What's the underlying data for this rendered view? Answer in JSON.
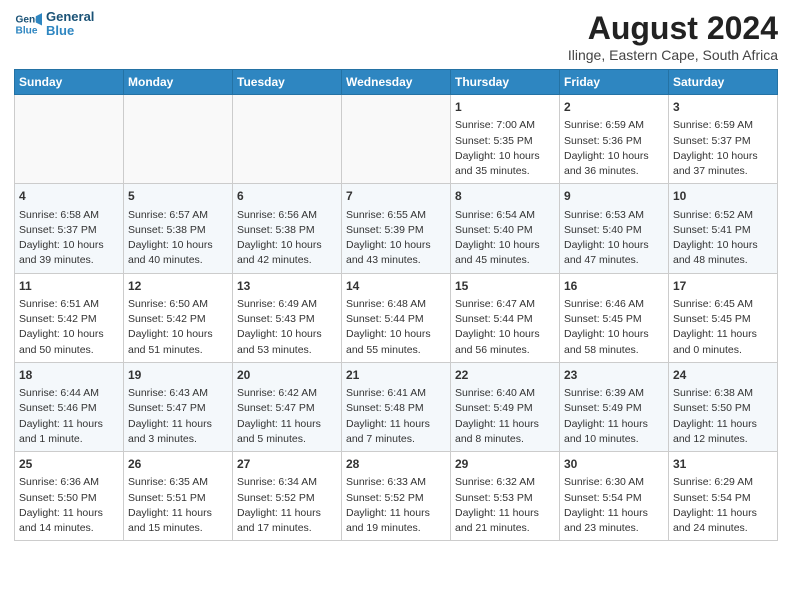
{
  "header": {
    "logo_line1": "General",
    "logo_line2": "Blue",
    "month_title": "August 2024",
    "location": "Ilinge, Eastern Cape, South Africa"
  },
  "weekdays": [
    "Sunday",
    "Monday",
    "Tuesday",
    "Wednesday",
    "Thursday",
    "Friday",
    "Saturday"
  ],
  "weeks": [
    [
      {
        "day": "",
        "info": ""
      },
      {
        "day": "",
        "info": ""
      },
      {
        "day": "",
        "info": ""
      },
      {
        "day": "",
        "info": ""
      },
      {
        "day": "1",
        "info": "Sunrise: 7:00 AM\nSunset: 5:35 PM\nDaylight: 10 hours\nand 35 minutes."
      },
      {
        "day": "2",
        "info": "Sunrise: 6:59 AM\nSunset: 5:36 PM\nDaylight: 10 hours\nand 36 minutes."
      },
      {
        "day": "3",
        "info": "Sunrise: 6:59 AM\nSunset: 5:37 PM\nDaylight: 10 hours\nand 37 minutes."
      }
    ],
    [
      {
        "day": "4",
        "info": "Sunrise: 6:58 AM\nSunset: 5:37 PM\nDaylight: 10 hours\nand 39 minutes."
      },
      {
        "day": "5",
        "info": "Sunrise: 6:57 AM\nSunset: 5:38 PM\nDaylight: 10 hours\nand 40 minutes."
      },
      {
        "day": "6",
        "info": "Sunrise: 6:56 AM\nSunset: 5:38 PM\nDaylight: 10 hours\nand 42 minutes."
      },
      {
        "day": "7",
        "info": "Sunrise: 6:55 AM\nSunset: 5:39 PM\nDaylight: 10 hours\nand 43 minutes."
      },
      {
        "day": "8",
        "info": "Sunrise: 6:54 AM\nSunset: 5:40 PM\nDaylight: 10 hours\nand 45 minutes."
      },
      {
        "day": "9",
        "info": "Sunrise: 6:53 AM\nSunset: 5:40 PM\nDaylight: 10 hours\nand 47 minutes."
      },
      {
        "day": "10",
        "info": "Sunrise: 6:52 AM\nSunset: 5:41 PM\nDaylight: 10 hours\nand 48 minutes."
      }
    ],
    [
      {
        "day": "11",
        "info": "Sunrise: 6:51 AM\nSunset: 5:42 PM\nDaylight: 10 hours\nand 50 minutes."
      },
      {
        "day": "12",
        "info": "Sunrise: 6:50 AM\nSunset: 5:42 PM\nDaylight: 10 hours\nand 51 minutes."
      },
      {
        "day": "13",
        "info": "Sunrise: 6:49 AM\nSunset: 5:43 PM\nDaylight: 10 hours\nand 53 minutes."
      },
      {
        "day": "14",
        "info": "Sunrise: 6:48 AM\nSunset: 5:44 PM\nDaylight: 10 hours\nand 55 minutes."
      },
      {
        "day": "15",
        "info": "Sunrise: 6:47 AM\nSunset: 5:44 PM\nDaylight: 10 hours\nand 56 minutes."
      },
      {
        "day": "16",
        "info": "Sunrise: 6:46 AM\nSunset: 5:45 PM\nDaylight: 10 hours\nand 58 minutes."
      },
      {
        "day": "17",
        "info": "Sunrise: 6:45 AM\nSunset: 5:45 PM\nDaylight: 11 hours\nand 0 minutes."
      }
    ],
    [
      {
        "day": "18",
        "info": "Sunrise: 6:44 AM\nSunset: 5:46 PM\nDaylight: 11 hours\nand 1 minute."
      },
      {
        "day": "19",
        "info": "Sunrise: 6:43 AM\nSunset: 5:47 PM\nDaylight: 11 hours\nand 3 minutes."
      },
      {
        "day": "20",
        "info": "Sunrise: 6:42 AM\nSunset: 5:47 PM\nDaylight: 11 hours\nand 5 minutes."
      },
      {
        "day": "21",
        "info": "Sunrise: 6:41 AM\nSunset: 5:48 PM\nDaylight: 11 hours\nand 7 minutes."
      },
      {
        "day": "22",
        "info": "Sunrise: 6:40 AM\nSunset: 5:49 PM\nDaylight: 11 hours\nand 8 minutes."
      },
      {
        "day": "23",
        "info": "Sunrise: 6:39 AM\nSunset: 5:49 PM\nDaylight: 11 hours\nand 10 minutes."
      },
      {
        "day": "24",
        "info": "Sunrise: 6:38 AM\nSunset: 5:50 PM\nDaylight: 11 hours\nand 12 minutes."
      }
    ],
    [
      {
        "day": "25",
        "info": "Sunrise: 6:36 AM\nSunset: 5:50 PM\nDaylight: 11 hours\nand 14 minutes."
      },
      {
        "day": "26",
        "info": "Sunrise: 6:35 AM\nSunset: 5:51 PM\nDaylight: 11 hours\nand 15 minutes."
      },
      {
        "day": "27",
        "info": "Sunrise: 6:34 AM\nSunset: 5:52 PM\nDaylight: 11 hours\nand 17 minutes."
      },
      {
        "day": "28",
        "info": "Sunrise: 6:33 AM\nSunset: 5:52 PM\nDaylight: 11 hours\nand 19 minutes."
      },
      {
        "day": "29",
        "info": "Sunrise: 6:32 AM\nSunset: 5:53 PM\nDaylight: 11 hours\nand 21 minutes."
      },
      {
        "day": "30",
        "info": "Sunrise: 6:30 AM\nSunset: 5:54 PM\nDaylight: 11 hours\nand 23 minutes."
      },
      {
        "day": "31",
        "info": "Sunrise: 6:29 AM\nSunset: 5:54 PM\nDaylight: 11 hours\nand 24 minutes."
      }
    ]
  ]
}
